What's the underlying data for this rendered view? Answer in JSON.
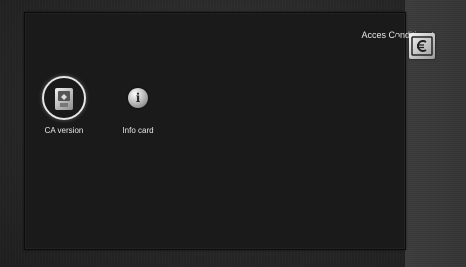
{
  "menu": {
    "title": "Acces Conditionat",
    "title_icon": "euro-card-icon"
  },
  "items": [
    {
      "label": "CA version",
      "icon": "ca-card-icon",
      "selected": true
    },
    {
      "label": "Info card",
      "icon": "info-icon",
      "glyph": "i",
      "selected": false
    }
  ],
  "colors": {
    "panel": "#1a1a1a",
    "text": "#e8e8e8",
    "focus_ring": "#e6e6e6"
  }
}
